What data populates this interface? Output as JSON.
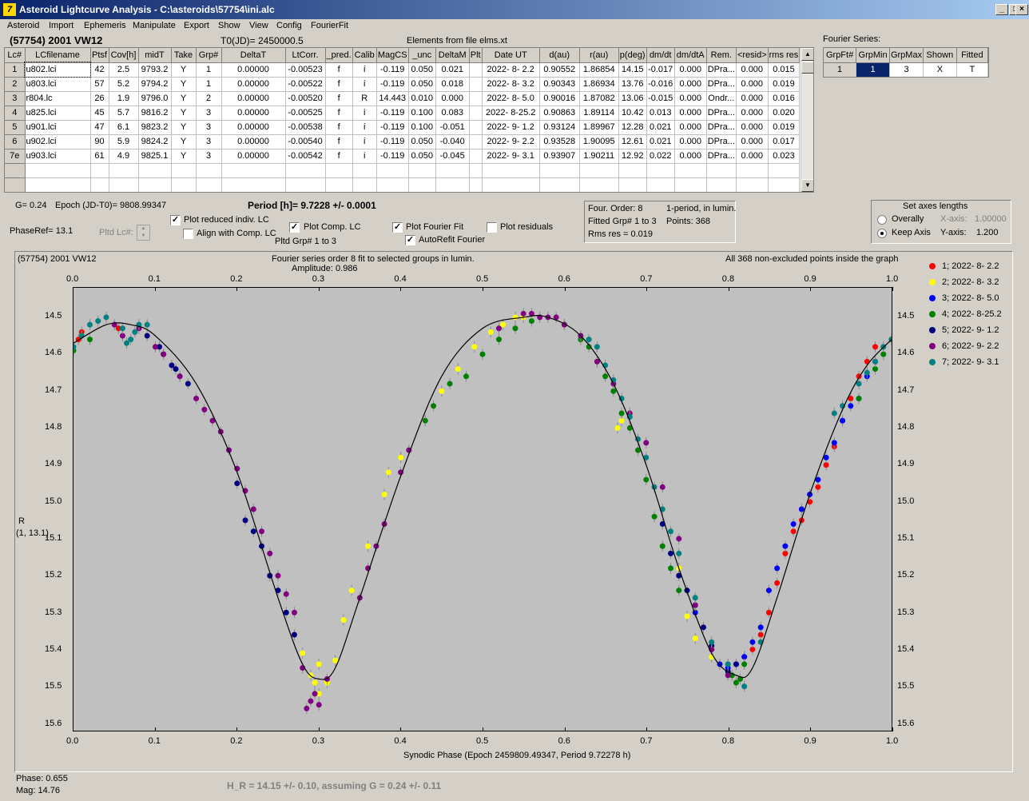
{
  "window": {
    "title": "Asteroid Lightcurve Analysis - C:\\asteroids\\57754\\ini.alc",
    "icon_glyph": "7",
    "min_glyph": "_",
    "max_glyph": "□",
    "close_glyph": "×"
  },
  "menu": [
    "Asteroid",
    "Import",
    "Ephemeris",
    "Manipulate",
    "Export",
    "Show",
    "View",
    "Config",
    "FourierFit"
  ],
  "header": {
    "object_name": "(57754) 2001 VW12",
    "t0": "T0(JD)= 2450000.5",
    "elements": "Elements from file elms.xt",
    "fourier_series_label": "Fourier Series:"
  },
  "lc_table": {
    "columns": [
      "Lc#",
      "LCfilename",
      "Ptsf",
      "Cov[h]",
      "midT",
      "Take",
      "Grp#",
      "DeltaT",
      "LtCorr.",
      "_pred.",
      "Calib",
      "MagCS",
      "_unc",
      "DeltaM",
      "Plt",
      "Date UT",
      "d(au)",
      "r(au)",
      "p(deg)",
      "dm/dt",
      "dm/dtA",
      "Rem.",
      "<resid>",
      "rms res"
    ],
    "rows": [
      [
        "1",
        "u802.lci",
        "42",
        "2.5",
        "9793.2",
        "Y",
        "1",
        "0.00000",
        "-0.00523",
        "f",
        "i",
        "-0.119",
        "0.050",
        "0.021",
        "",
        "2022- 8- 2.2",
        "0.90552",
        "1.86854",
        "14.15",
        "-0.017",
        "0.000",
        "DPra...",
        "0.000",
        "0.015"
      ],
      [
        "2",
        "u803.lci",
        "57",
        "5.2",
        "9794.2",
        "Y",
        "1",
        "0.00000",
        "-0.00522",
        "f",
        "i",
        "-0.119",
        "0.050",
        "0.018",
        "",
        "2022- 8- 3.2",
        "0.90343",
        "1.86934",
        "13.76",
        "-0.016",
        "0.000",
        "DPra...",
        "0.000",
        "0.019"
      ],
      [
        "3",
        "r804.lc",
        "26",
        "1.9",
        "9796.0",
        "Y",
        "2",
        "0.00000",
        "-0.00520",
        "f",
        "R",
        "14.443",
        "0.010",
        "0.000",
        "",
        "2022- 8- 5.0",
        "0.90016",
        "1.87082",
        "13.06",
        "-0.015",
        "0.000",
        "Ondr...",
        "0.000",
        "0.016"
      ],
      [
        "4",
        "u825.lci",
        "45",
        "5.7",
        "9816.2",
        "Y",
        "3",
        "0.00000",
        "-0.00525",
        "f",
        "i",
        "-0.119",
        "0.100",
        "0.083",
        "",
        "2022- 8-25.2",
        "0.90863",
        "1.89114",
        "10.42",
        "0.013",
        "0.000",
        "DPra...",
        "0.000",
        "0.020"
      ],
      [
        "5",
        "u901.lci",
        "47",
        "6.1",
        "9823.2",
        "Y",
        "3",
        "0.00000",
        "-0.00538",
        "f",
        "i",
        "-0.119",
        "0.100",
        "-0.051",
        "",
        "2022- 9- 1.2",
        "0.93124",
        "1.89967",
        "12.28",
        "0.021",
        "0.000",
        "DPra...",
        "0.000",
        "0.019"
      ],
      [
        "6",
        "u902.lci",
        "90",
        "5.9",
        "9824.2",
        "Y",
        "3",
        "0.00000",
        "-0.00540",
        "f",
        "i",
        "-0.119",
        "0.050",
        "-0.040",
        "",
        "2022- 9- 2.2",
        "0.93528",
        "1.90095",
        "12.61",
        "0.021",
        "0.000",
        "DPra...",
        "0.000",
        "0.017"
      ],
      [
        "7e",
        "u903.lci",
        "61",
        "4.9",
        "9825.1",
        "Y",
        "3",
        "0.00000",
        "-0.00542",
        "f",
        "i",
        "-0.119",
        "0.050",
        "-0.045",
        "",
        "2022- 9- 3.1",
        "0.93907",
        "1.90211",
        "12.92",
        "0.022",
        "0.000",
        "DPra...",
        "0.000",
        "0.023"
      ]
    ]
  },
  "fourier_table": {
    "columns": [
      "GrpFt#",
      "GrpMin",
      "GrpMax",
      "Shown",
      "Fitted"
    ],
    "row": [
      "1",
      "1",
      "3",
      "X",
      "T"
    ]
  },
  "controls": {
    "g_value": "G= 0.24",
    "epoch": "Epoch (JD-T0)= 9808.99347",
    "period": "Period [h]= 9.7228 +/- 0.0001",
    "phase_ref": "PhaseRef= 13.1",
    "pltd_lc": "Pltd Lc#:",
    "plot_reduced": "Plot reduced indiv. LC",
    "align_comp": "Align with Comp. LC",
    "plot_comp": "Plot Comp. LC",
    "pltd_grp": "Pltd Grp#  1   to   3",
    "plot_fourier": "Plot Fourier Fit",
    "autorefit": "AutoRefit Fourier",
    "plot_residuals": "Plot residuals",
    "check_mark": "✓",
    "spin_up": "▲",
    "spin_down": "▼",
    "scroll_up": "▲",
    "scroll_down": "▼",
    "four_order": "Four. Order:  8",
    "one_period": "1-period, in lumin.",
    "fitted_grp": "Fitted Grp# 1 to 3",
    "points": "Points: 368",
    "rms_res": "Rms res      = 0.019",
    "set_axes_title": "Set axes lengths",
    "overally": "Overally",
    "keep_axis": "Keep Axis",
    "x_axis_label": "X-axis:",
    "x_axis_value": "1.00000",
    "y_axis_label": "Y-axis:",
    "y_axis_value": "1.200"
  },
  "plot": {
    "object": "(57754) 2001 VW12",
    "fit_title": "Fourier series order 8 fit to selected groups in lumin.",
    "amplitude": "Amplitude: 0.986",
    "points_note": "All 368 non-excluded points inside the graph",
    "ylabel": "R",
    "ylabel2": "(1, 13.1)",
    "xlabel": "Synodic Phase (Epoch 2459809.49347, Period 9.72278 h)",
    "x_ticks": [
      "0.0",
      "0.1",
      "0.2",
      "0.3",
      "0.4",
      "0.5",
      "0.6",
      "0.7",
      "0.8",
      "0.9",
      "1.0"
    ],
    "y_ticks": [
      "14.5",
      "14.6",
      "14.7",
      "14.8",
      "14.9",
      "15.0",
      "15.1",
      "15.2",
      "15.3",
      "15.4",
      "15.5",
      "15.6"
    ]
  },
  "status": {
    "phase": "Phase:  0.655",
    "mag": "Mag:    14.76",
    "hr": "H_R = 14.15 +/- 0.10, assuming G = 0.24 +/- 0.11"
  },
  "chart_data": {
    "type": "scatter",
    "title": "Fourier series order 8 fit to selected groups in lumin.",
    "subtitle": "Amplitude: 0.986",
    "xlabel": "Synodic Phase (Epoch 2459809.49347, Period 9.72278 h)",
    "ylabel": "R",
    "xlim": [
      0,
      1
    ],
    "ylim": [
      14.42,
      15.62
    ],
    "y_inverted": true,
    "grid": false,
    "legend_position": "right",
    "fit_curve": {
      "phase": [
        0.0,
        0.04,
        0.07,
        0.1,
        0.15,
        0.2,
        0.25,
        0.28,
        0.3,
        0.32,
        0.35,
        0.4,
        0.45,
        0.5,
        0.55,
        0.58,
        0.62,
        0.66,
        0.7,
        0.74,
        0.78,
        0.81,
        0.83,
        0.86,
        0.9,
        0.94,
        0.97,
        1.0
      ],
      "mag": [
        14.57,
        14.52,
        14.52,
        14.55,
        14.68,
        14.92,
        15.26,
        15.44,
        15.48,
        15.45,
        15.26,
        14.93,
        14.66,
        14.53,
        14.5,
        14.5,
        14.55,
        14.68,
        14.9,
        15.18,
        15.41,
        15.47,
        15.45,
        15.26,
        14.98,
        14.75,
        14.63,
        14.56
      ]
    },
    "series": [
      {
        "name": "1; 2022- 8- 2.2",
        "color": "#ff0000",
        "x": [
          0.84,
          0.86,
          0.88,
          0.9,
          0.92,
          0.94,
          0.96,
          0.97,
          0.98,
          0.83,
          0.85,
          0.89,
          0.91,
          0.93,
          0.95,
          0.82,
          0.87,
          0.006,
          0.01,
          0.055
        ],
        "y": [
          15.36,
          15.22,
          15.08,
          15.0,
          14.9,
          14.78,
          14.66,
          14.62,
          14.58,
          15.4,
          15.3,
          15.05,
          14.96,
          14.85,
          14.72,
          15.42,
          15.14,
          14.56,
          14.54,
          14.53
        ]
      },
      {
        "name": "2; 2022- 8- 3.2",
        "color": "#ffff00",
        "x": [
          0.28,
          0.29,
          0.3,
          0.31,
          0.32,
          0.33,
          0.34,
          0.36,
          0.38,
          0.4,
          0.43,
          0.45,
          0.47,
          0.49,
          0.51,
          0.525,
          0.54,
          0.55,
          0.74,
          0.75,
          0.76,
          0.78,
          0.8,
          0.79,
          0.67,
          0.665,
          0.385,
          0.3,
          0.295
        ],
        "y": [
          15.41,
          15.47,
          15.44,
          15.49,
          15.43,
          15.32,
          15.24,
          15.12,
          14.98,
          14.88,
          14.78,
          14.7,
          14.64,
          14.58,
          14.54,
          14.52,
          14.5,
          14.5,
          15.18,
          15.31,
          15.37,
          15.42,
          15.46,
          15.44,
          14.78,
          14.8,
          14.92,
          15.52,
          15.49
        ]
      },
      {
        "name": "3; 2022- 8- 5.0",
        "color": "#0000ff",
        "x": [
          0.76,
          0.78,
          0.79,
          0.8,
          0.81,
          0.82,
          0.84,
          0.86,
          0.88,
          0.9,
          0.92,
          0.94,
          0.96,
          0.97,
          0.98,
          0.85,
          0.87,
          0.89,
          0.91,
          0.93,
          0.95,
          0.83
        ],
        "y": [
          15.3,
          15.4,
          15.44,
          15.45,
          15.44,
          15.42,
          15.34,
          15.18,
          15.06,
          14.98,
          14.88,
          14.78,
          14.72,
          14.66,
          14.62,
          15.24,
          15.12,
          15.02,
          14.94,
          14.84,
          14.74,
          15.38
        ]
      },
      {
        "name": "4; 2022- 8-25.2",
        "color": "#008000",
        "x": [
          0.0,
          0.02,
          0.43,
          0.44,
          0.46,
          0.48,
          0.5,
          0.52,
          0.54,
          0.56,
          0.6,
          0.62,
          0.63,
          0.64,
          0.65,
          0.66,
          0.67,
          0.68,
          0.69,
          0.7,
          0.71,
          0.72,
          0.73,
          0.74,
          0.81,
          0.82,
          0.96,
          0.98,
          0.99,
          1.0,
          0.805,
          0.815
        ],
        "y": [
          14.59,
          14.56,
          14.78,
          14.74,
          14.68,
          14.66,
          14.6,
          14.56,
          14.53,
          14.51,
          14.52,
          14.56,
          14.58,
          14.62,
          14.66,
          14.7,
          14.76,
          14.8,
          14.86,
          14.94,
          15.04,
          15.12,
          15.18,
          15.24,
          15.49,
          15.44,
          14.72,
          14.64,
          14.6,
          14.56,
          15.47,
          15.48
        ]
      },
      {
        "name": "5; 2022- 9- 1.2",
        "color": "#000080",
        "x": [
          0.09,
          0.11,
          0.12,
          0.13,
          0.14,
          0.2,
          0.21,
          0.22,
          0.23,
          0.24,
          0.25,
          0.26,
          0.27,
          0.76,
          0.77,
          0.78,
          0.8,
          0.81,
          0.72,
          0.73,
          0.74,
          0.75,
          0.105,
          0.125
        ],
        "y": [
          14.55,
          14.6,
          14.63,
          14.66,
          14.68,
          14.95,
          15.05,
          15.08,
          15.12,
          15.2,
          15.24,
          15.3,
          15.36,
          15.28,
          15.34,
          15.39,
          15.46,
          15.44,
          15.06,
          15.14,
          15.2,
          15.24,
          14.58,
          14.64
        ]
      },
      {
        "name": "6; 2022- 9- 2.2",
        "color": "#800080",
        "x": [
          0.05,
          0.06,
          0.08,
          0.1,
          0.11,
          0.13,
          0.15,
          0.16,
          0.17,
          0.18,
          0.19,
          0.2,
          0.21,
          0.22,
          0.23,
          0.24,
          0.25,
          0.26,
          0.27,
          0.28,
          0.29,
          0.3,
          0.31,
          0.285,
          0.295,
          0.37,
          0.38,
          0.4,
          0.41,
          0.52,
          0.55,
          0.56,
          0.57,
          0.58,
          0.59,
          0.6,
          0.62,
          0.64,
          0.66,
          0.68,
          0.7,
          0.72,
          0.74,
          0.76,
          0.78,
          0.8,
          0.35,
          0.36
        ],
        "y": [
          14.52,
          14.55,
          14.53,
          14.58,
          14.6,
          14.66,
          14.72,
          14.75,
          14.78,
          14.81,
          14.86,
          14.91,
          14.97,
          15.02,
          15.08,
          15.14,
          15.2,
          15.25,
          15.3,
          15.45,
          15.54,
          15.55,
          15.48,
          15.56,
          15.52,
          15.12,
          15.06,
          14.92,
          14.86,
          14.53,
          14.49,
          14.49,
          14.5,
          14.5,
          14.5,
          14.52,
          14.55,
          14.62,
          14.68,
          14.76,
          14.84,
          14.96,
          15.1,
          15.28,
          15.4,
          15.47,
          15.26,
          15.18
        ]
      },
      {
        "name": "7; 2022- 9- 3.1",
        "color": "#008080",
        "x": [
          0.0,
          0.01,
          0.02,
          0.03,
          0.04,
          0.06,
          0.07,
          0.08,
          0.09,
          0.63,
          0.64,
          0.65,
          0.66,
          0.67,
          0.68,
          0.69,
          0.7,
          0.71,
          0.72,
          0.73,
          0.74,
          0.76,
          0.78,
          0.8,
          0.82,
          0.84,
          0.93,
          0.94,
          0.96,
          0.97,
          0.98,
          0.99,
          1.0,
          0.065,
          0.075
        ],
        "y": [
          14.58,
          14.55,
          14.52,
          14.51,
          14.5,
          14.53,
          14.56,
          14.52,
          14.52,
          14.56,
          14.58,
          14.63,
          14.67,
          14.72,
          14.77,
          14.83,
          14.88,
          14.96,
          15.02,
          15.08,
          15.14,
          15.26,
          15.38,
          15.44,
          15.5,
          15.38,
          14.76,
          14.74,
          14.68,
          14.65,
          14.62,
          14.58,
          14.56,
          14.57,
          14.54
        ]
      }
    ]
  }
}
